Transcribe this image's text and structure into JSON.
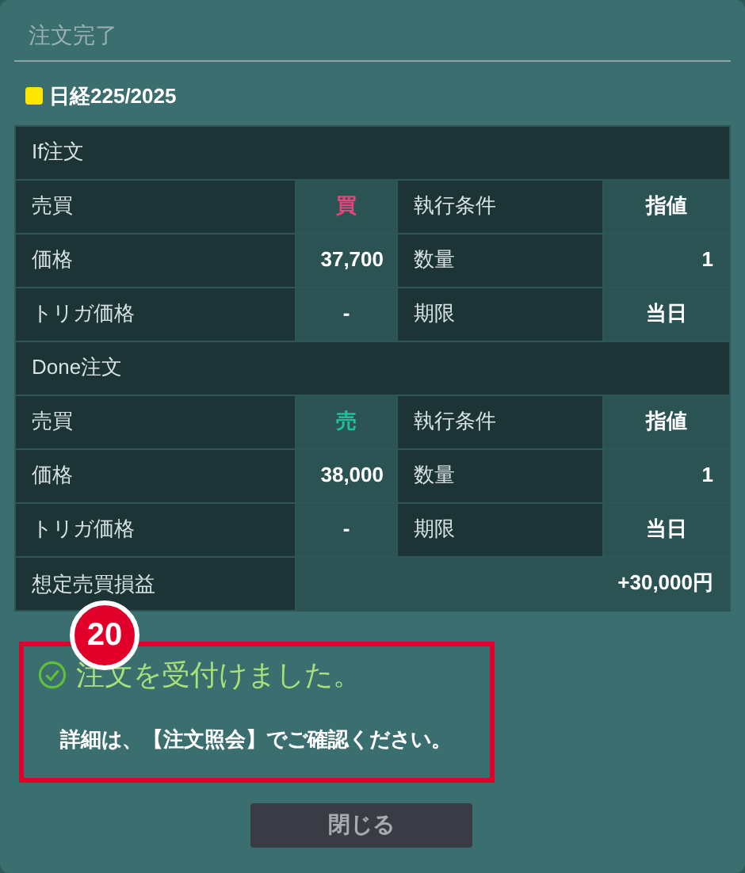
{
  "dialog_title": "注文完了",
  "symbol": {
    "name": "日経225/2025",
    "color": "#ffe600"
  },
  "orders": [
    {
      "title": "If注文",
      "rows": [
        {
          "kind": "side",
          "buy": true,
          "label": "売買",
          "value": "買",
          "label_2": "執行条件",
          "value_2": "指値"
        },
        {
          "kind": "price",
          "label": "価格",
          "value": "37,700",
          "label_2": "数量",
          "value_2": "1"
        },
        {
          "kind": "trigger",
          "label": "トリガ価格",
          "value": "-",
          "label_2": "期限",
          "value_2": "当日"
        }
      ]
    },
    {
      "title": "Done注文",
      "rows": [
        {
          "kind": "side",
          "buy": false,
          "label": "売買",
          "value": "売",
          "label_2": "執行条件",
          "value_2": "指値"
        },
        {
          "kind": "price",
          "label": "価格",
          "value": "38,000",
          "label_2": "数量",
          "value_2": "1"
        },
        {
          "kind": "trigger",
          "label": "トリガ価格",
          "value": "-",
          "label_2": "期限",
          "value_2": "当日"
        }
      ]
    }
  ],
  "estimated_profit": {
    "label": "想定売買損益",
    "value": "+30,000円"
  },
  "annotation": {
    "number": "20"
  },
  "message": {
    "title": "注文を受付けました。",
    "detail": "詳細は、【注文照会】でご確認ください。"
  },
  "close_button": "閉じる"
}
